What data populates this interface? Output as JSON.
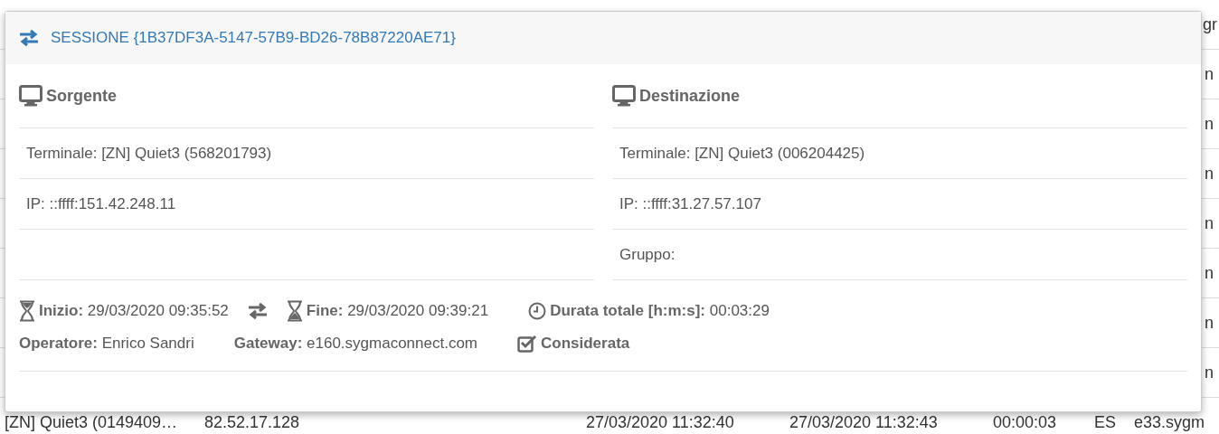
{
  "background_table": {
    "header_fragment": "gr",
    "row_fragments": [
      "n",
      "n",
      "n",
      "n",
      "n",
      "n",
      "n"
    ],
    "last_row": [
      "[ZN] Quiet3 (0149409…",
      "82.52.17.128",
      "27/03/2020 11:32:40",
      "27/03/2020 11:32:43",
      "00:00:03",
      "ES",
      "e33.sygm"
    ]
  },
  "modal": {
    "title": "SESSIONE {1B37DF3A-5147-57B9-BD26-78B87220AE71}",
    "columns": [
      {
        "title": "Sorgente",
        "rows": [
          "Terminale: [ZN] Quiet3 (568201793)",
          "IP: ::ffff:151.42.248.11"
        ]
      },
      {
        "title": "Destinazione",
        "rows": [
          "Terminale: [ZN] Quiet3 (006204425)",
          "IP: ::ffff:31.27.57.107",
          "Gruppo:"
        ]
      }
    ],
    "footer_lines": [
      [
        {
          "kind": "start",
          "label": "Inizio:",
          "value": "29/03/2020 09:35:52"
        },
        {
          "kind": "swap"
        },
        {
          "kind": "end",
          "label": "Fine:",
          "value": "29/03/2020 09:39:21"
        },
        {
          "kind": "duration",
          "label": "Durata totale [h:m:s]:",
          "value": "00:03:29"
        }
      ],
      [
        {
          "kind": "plain",
          "label": "Operatore:",
          "value": "Enrico Sandri"
        },
        {
          "kind": "plain",
          "label": "Gateway:",
          "value": "e160.sygmaconnect.com"
        },
        {
          "kind": "check",
          "label": "Considerata",
          "checked": true
        }
      ]
    ]
  }
}
